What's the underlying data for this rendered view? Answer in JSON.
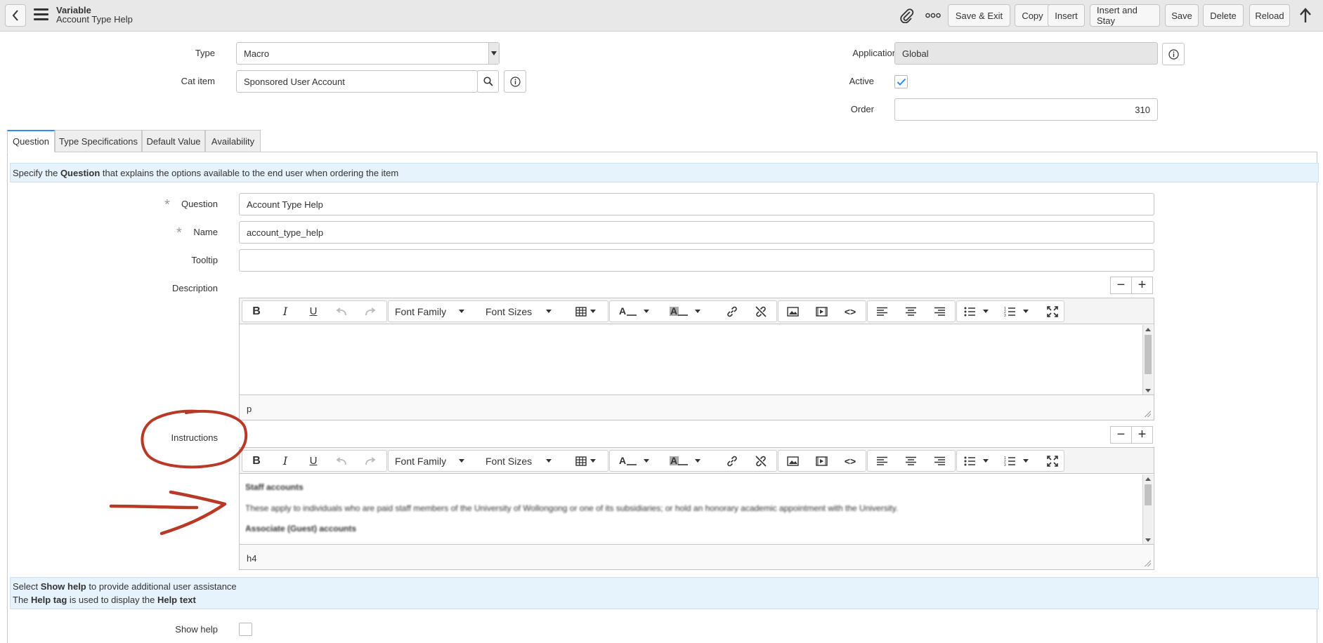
{
  "header": {
    "record_type": "Variable",
    "record_name": "Account Type Help",
    "buttons": {
      "save_exit": "Save & Exit",
      "copy": "Copy",
      "insert": "Insert",
      "insert_stay": "Insert and Stay",
      "save": "Save",
      "delete": "Delete",
      "reload": "Reload"
    },
    "icons": [
      "back-chevron-icon",
      "hamburger-menu-icon",
      "paperclip-icon",
      "more-options-icon",
      "scroll-top-arrow-icon"
    ]
  },
  "form": {
    "type_label": "Type",
    "type_value": "Macro",
    "cat_item_label": "Cat item",
    "cat_item_value": "Sponsored User Account",
    "application_label": "Application",
    "application_value": "Global",
    "active_label": "Active",
    "active_checked": true,
    "order_label": "Order",
    "order_value": "310"
  },
  "tabs": [
    {
      "label": "Question",
      "active": true
    },
    {
      "label": "Type Specifications",
      "active": false
    },
    {
      "label": "Default Value",
      "active": false
    },
    {
      "label": "Availability",
      "active": false
    }
  ],
  "question_tab": {
    "info_prefix": "Specify the ",
    "info_bold": "Question",
    "info_suffix": " that explains the options available to the end user when ordering the item",
    "question_label": "Question",
    "question_value": "Account Type Help",
    "name_label": "Name",
    "name_value": "account_type_help",
    "tooltip_label": "Tooltip",
    "tooltip_value": "",
    "description_label": "Description",
    "description_status": "p",
    "instructions_label": "Instructions",
    "instructions_status": "h4",
    "instructions_content": {
      "heading_1": "Staff accounts",
      "paragraph_1": "These apply to individuals who are paid staff members of the University of Wollongong or one of its subsidiaries; or hold an honorary academic appointment with the University.",
      "heading_2": "Associate (Guest) accounts"
    },
    "help_info": {
      "line1_prefix": "Select ",
      "line1_bold": "Show help",
      "line1_suffix": " to provide additional user assistance",
      "line2_prefix": "The ",
      "line2_bold1": "Help tag",
      "line2_mid": " is used to display the ",
      "line2_bold2": "Help text"
    },
    "show_help_label": "Show help",
    "show_help_checked": false
  },
  "editor_toolbar": {
    "bold": "B",
    "italic": "I",
    "underline": "U",
    "font_family": "Font Family",
    "font_sizes": "Font Sizes",
    "source_code": "<>",
    "expand_minus": "−",
    "expand_plus": "+"
  },
  "annotation_color": "#b83a26",
  "accent_color": "#278efc"
}
